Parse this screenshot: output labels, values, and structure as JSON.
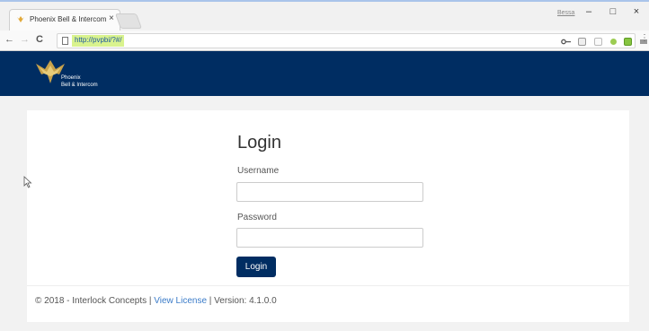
{
  "browser": {
    "tab_title": "Phoenix Bell & Intercom",
    "tab_close": "×",
    "url": "http://pvpbi/?#/",
    "user_label": "Bessa",
    "minimize": "–",
    "maximize": "□",
    "close": "×",
    "back": "←",
    "forward": "→",
    "reload": "C",
    "menu": "⋮",
    "icons": [
      "key-icon",
      "extension-icon",
      "bookmark-icon",
      "lightbulb-icon",
      "green-extension-icon",
      "cast-icon"
    ]
  },
  "header": {
    "logo_text": "Phoenix\nBell & Intercom",
    "brand_color": "#002d62"
  },
  "login": {
    "title": "Login",
    "username_label": "Username",
    "username_value": "",
    "password_label": "Password",
    "password_value": "",
    "button_label": "Login"
  },
  "footer": {
    "copyright": "© 2018 - Interlock Concepts | ",
    "license_link": "View License",
    "separator": " | ",
    "version": "Version: 4.1.0.0",
    "link_color": "#3a7bc8"
  }
}
